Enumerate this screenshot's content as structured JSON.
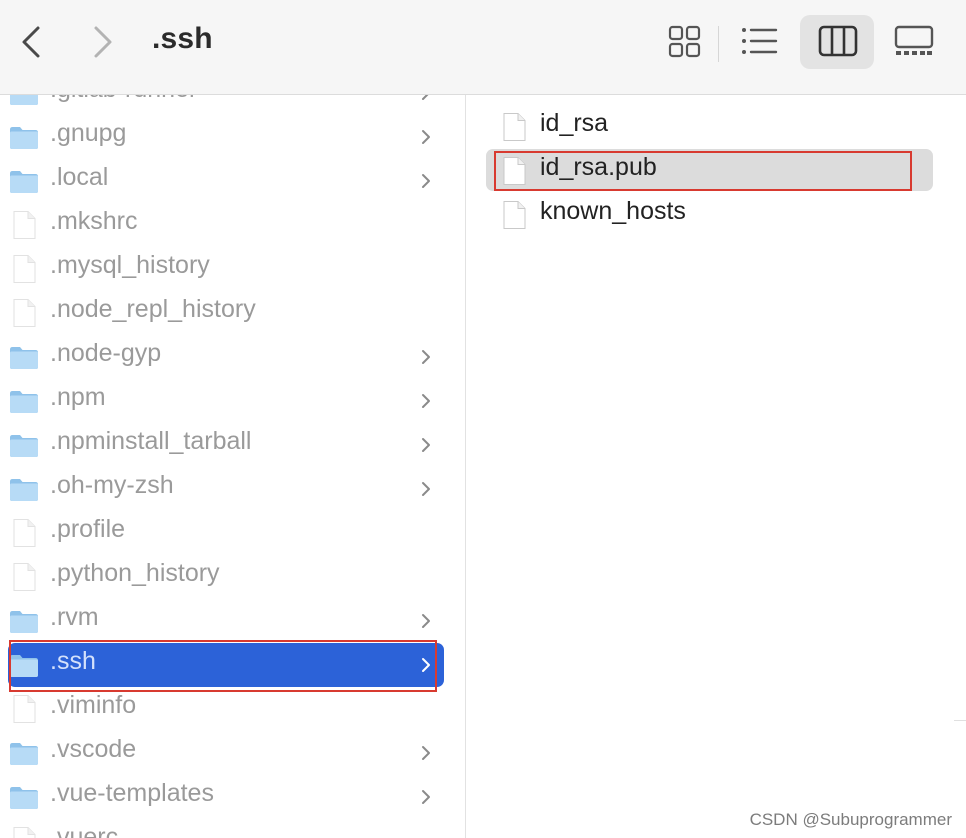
{
  "window": {
    "title": ".ssh"
  },
  "toolbar": {
    "view_buttons": [
      "icon-view-icon",
      "list-view-icon",
      "column-view-icon",
      "gallery-view-icon"
    ],
    "active_view": "column"
  },
  "sidebar_column": {
    "items": [
      {
        "label": ".gitlab-runner",
        "kind": "folder"
      },
      {
        "label": ".gnupg",
        "kind": "folder"
      },
      {
        "label": ".local",
        "kind": "folder"
      },
      {
        "label": ".mkshrc",
        "kind": "file"
      },
      {
        "label": ".mysql_history",
        "kind": "file"
      },
      {
        "label": ".node_repl_history",
        "kind": "file"
      },
      {
        "label": ".node-gyp",
        "kind": "folder"
      },
      {
        "label": ".npm",
        "kind": "folder"
      },
      {
        "label": ".npminstall_tarball",
        "kind": "folder"
      },
      {
        "label": ".oh-my-zsh",
        "kind": "folder"
      },
      {
        "label": ".profile",
        "kind": "file"
      },
      {
        "label": ".python_history",
        "kind": "file"
      },
      {
        "label": ".rvm",
        "kind": "folder"
      },
      {
        "label": ".ssh",
        "kind": "folder",
        "selected": true
      },
      {
        "label": ".viminfo",
        "kind": "file"
      },
      {
        "label": ".vscode",
        "kind": "folder"
      },
      {
        "label": ".vue-templates",
        "kind": "folder"
      },
      {
        "label": ".vuerc",
        "kind": "file"
      }
    ]
  },
  "ssh_column": {
    "items": [
      {
        "label": "id_rsa",
        "kind": "file"
      },
      {
        "label": "id_rsa.pub",
        "kind": "file",
        "highlighted": true
      },
      {
        "label": "known_hosts",
        "kind": "file"
      }
    ]
  },
  "watermark": "CSDN @Subuprogrammer",
  "colors": {
    "selection": "#2c62d8",
    "annotation_box": "#d83a30",
    "folder": "#9ccbef",
    "toolbar_bg": "#f6f6f6"
  }
}
